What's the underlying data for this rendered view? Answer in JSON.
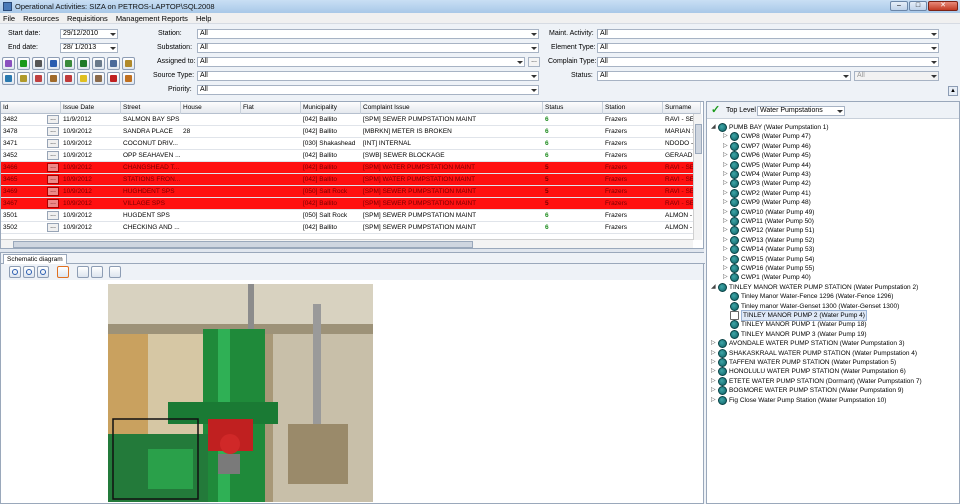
{
  "window": {
    "title": "Operational Activities: SIZA on PETROS-LAPTOP\\SQL2008"
  },
  "menu": [
    "File",
    "Resources",
    "Requisitions",
    "Management Reports",
    "Help"
  ],
  "filters": {
    "start_date_label": "Start date:",
    "start_date": "29/12/2010",
    "end_date_label": "End date:",
    "end_date": "28/  1/2013",
    "station_label": "Station:",
    "station": "All",
    "substation_label": "Substation:",
    "substation": "All",
    "assigned_label": "Assigned to:",
    "assigned": "All",
    "source_label": "Source Type:",
    "source": "All",
    "priority_label": "Priority:",
    "priority": "All",
    "maint_label": "Maint. Activity:",
    "maint": "All",
    "element_label": "Element Type:",
    "element": "All",
    "complain_label": "Complain Type:",
    "complain": "All",
    "status_label": "Status:",
    "status": "All",
    "status2": "All",
    "ellipsis": "..."
  },
  "grid": {
    "columns": [
      "Id",
      "Issue Date",
      "Street",
      "House",
      "Flat",
      "Municipality",
      "Complaint Issue",
      "Status",
      "Station",
      "Surname"
    ],
    "rows": [
      {
        "id": "3482",
        "date": "11/9/2012",
        "street": "SALMON BAY SPS",
        "house": "",
        "flat": "",
        "muni": "[042] Ballito",
        "issue": "[SPM] SEWER PUMPSTATION MAINT",
        "status": "6",
        "station": "Frazers",
        "surname": "RAVI - SE",
        "red": false
      },
      {
        "id": "3478",
        "date": "10/9/2012",
        "street": "SANDRA PLACE",
        "house": "28",
        "flat": "",
        "muni": "[042] Ballito",
        "issue": "[MBRKN] METER IS BROKEN",
        "status": "6",
        "station": "Frazers",
        "surname": "MARIAN S",
        "red": false
      },
      {
        "id": "3471",
        "date": "10/9/2012",
        "street": "COCONUT DRIV...",
        "house": "",
        "flat": "",
        "muni": "[030] Shakashead",
        "issue": "[INT] INTERNAL",
        "status": "6",
        "station": "Frazers",
        "surname": "NDODO -",
        "red": false
      },
      {
        "id": "3452",
        "date": "10/9/2012",
        "street": "OPP SEAHAVEN ...",
        "house": "",
        "flat": "",
        "muni": "[042] Ballito",
        "issue": "[SWB] SEWER BLOCKAGE",
        "status": "6",
        "station": "Frazers",
        "surname": "GERAAD (",
        "red": false
      },
      {
        "id": "3466",
        "date": "10/9/2012",
        "street": "CHANGSHEAD T...",
        "house": "",
        "flat": "",
        "muni": "[042] Ballito",
        "issue": "[SPM] WATER PUMPSTATION MAINT",
        "status": "5",
        "station": "Frazers",
        "surname": "RAVI - SE",
        "red": true
      },
      {
        "id": "3465",
        "date": "10/9/2012",
        "street": "STATIONS FRON...",
        "house": "",
        "flat": "",
        "muni": "[042] Ballito",
        "issue": "[SPM] WATER PUMPSTATION MAINT",
        "status": "5",
        "station": "Frazers",
        "surname": "RAVI - SE",
        "red": true
      },
      {
        "id": "3469",
        "date": "10/9/2012",
        "street": "HUGHDENT SPS",
        "house": "",
        "flat": "",
        "muni": "[050] Salt Rock",
        "issue": "[SPM] SEWER PUMPSTATION MAINT",
        "status": "5",
        "station": "Frazers",
        "surname": "RAVI - SE",
        "red": true
      },
      {
        "id": "3467",
        "date": "10/9/2012",
        "street": "VILLAGE SPS",
        "house": "",
        "flat": "",
        "muni": "[042] Ballito",
        "issue": "[SPM] SEWER PUMPSTATION MAINT",
        "status": "5",
        "station": "Frazers",
        "surname": "RAVI - SE",
        "red": true
      },
      {
        "id": "3501",
        "date": "10/9/2012",
        "street": "HUGDENT SPS",
        "house": "",
        "flat": "",
        "muni": "[050] Salt Rock",
        "issue": "[SPM] SEWER PUMPSTATION MAINT",
        "status": "6",
        "station": "Frazers",
        "surname": "ALMON - S",
        "red": false
      },
      {
        "id": "3502",
        "date": "10/9/2012",
        "street": "CHECKING AND ...",
        "house": "",
        "flat": "",
        "muni": "[042] Ballito",
        "issue": "[SPM] SEWER PUMPSTATION MAINT",
        "status": "6",
        "station": "Frazers",
        "surname": "ALMON - S",
        "red": false
      }
    ]
  },
  "schematic": {
    "tab": "Schematic diagram"
  },
  "tree": {
    "top_level_label": "Top Level",
    "top_level_value": "Water Pumpstations",
    "nodes": [
      {
        "text": "PUMB BAY (Water Pumpstation 1)",
        "level": 0,
        "exp": "◢"
      },
      {
        "text": "CWP8 (Water Pump 47)",
        "level": 1,
        "exp": "▷"
      },
      {
        "text": "CWP7 (Water Pump 46)",
        "level": 1,
        "exp": "▷"
      },
      {
        "text": "CWP6 (Water Pump 45)",
        "level": 1,
        "exp": "▷"
      },
      {
        "text": "CWP5 (Water Pump 44)",
        "level": 1,
        "exp": "▷"
      },
      {
        "text": "CWP4 (Water Pump 43)",
        "level": 1,
        "exp": "▷"
      },
      {
        "text": "CWP3 (Water Pump 42)",
        "level": 1,
        "exp": "▷"
      },
      {
        "text": "CWP2 (Water Pump 41)",
        "level": 1,
        "exp": "▷"
      },
      {
        "text": "CWP9 (Water Pump 48)",
        "level": 1,
        "exp": "▷"
      },
      {
        "text": "CWP10 (Water Pump 49)",
        "level": 1,
        "exp": "▷"
      },
      {
        "text": "CWP11 (Water Pump 50)",
        "level": 1,
        "exp": "▷"
      },
      {
        "text": "CWP12 (Water Pump 51)",
        "level": 1,
        "exp": "▷"
      },
      {
        "text": "CWP13 (Water Pump 52)",
        "level": 1,
        "exp": "▷"
      },
      {
        "text": "CWP14 (Water Pump 53)",
        "level": 1,
        "exp": "▷"
      },
      {
        "text": "CWP15 (Water Pump 54)",
        "level": 1,
        "exp": "▷"
      },
      {
        "text": "CWP16 (Water Pump 55)",
        "level": 1,
        "exp": "▷"
      },
      {
        "text": "CWP1 (Water Pump 40)",
        "level": 1,
        "exp": "▷"
      },
      {
        "text": "TINLEY MANOR WATER PUMP STATION (Water Pumpstation 2)",
        "level": 0,
        "exp": "◢"
      },
      {
        "text": "Tinley Manor Water-Fence 1296 (Water-Fence 1296)",
        "level": 1,
        "exp": ""
      },
      {
        "text": "Tinley manor Water-Genset 1300 (Water-Genset 1300)",
        "level": 1,
        "exp": ""
      },
      {
        "text": "TINLEY MANOR PUMP 2 (Water Pump 4)",
        "level": 1,
        "exp": "",
        "sel": true,
        "doc": true
      },
      {
        "text": "TINLEY MANOR PUMP 1 (Water Pump 18)",
        "level": 1,
        "exp": ""
      },
      {
        "text": "TINLEY MANOR PUMP 3 (Water Pump 19)",
        "level": 1,
        "exp": ""
      },
      {
        "text": "AVONDALE WATER PUMP STATION (Water Pumpstation 3)",
        "level": 0,
        "exp": "▷"
      },
      {
        "text": "SHAKASKRAAL WATER PUMP STATION (Water Pumpstation 4)",
        "level": 0,
        "exp": "▷"
      },
      {
        "text": "TAFFENI WATER PUMP STATION (Water Pumpstation 5)",
        "level": 0,
        "exp": "▷"
      },
      {
        "text": "HONOLULU WATER PUMP STATION (Water Pumpstation 6)",
        "level": 0,
        "exp": "▷"
      },
      {
        "text": "ETETE WATER PUMP STATION (Dormant) (Water Pumpstation 7)",
        "level": 0,
        "exp": "▷"
      },
      {
        "text": "BOGMORE WATER PUMP STATION (Water Pumpstation 9)",
        "level": 0,
        "exp": "▷"
      },
      {
        "text": "Fig Close Water Pump Station (Water Pumpstation 10)",
        "level": 0,
        "exp": "▷"
      }
    ]
  },
  "colors": {
    "red_row": "#ff1010",
    "status_green": "#1a8a1a",
    "title_bar": "#a8c8e8"
  }
}
